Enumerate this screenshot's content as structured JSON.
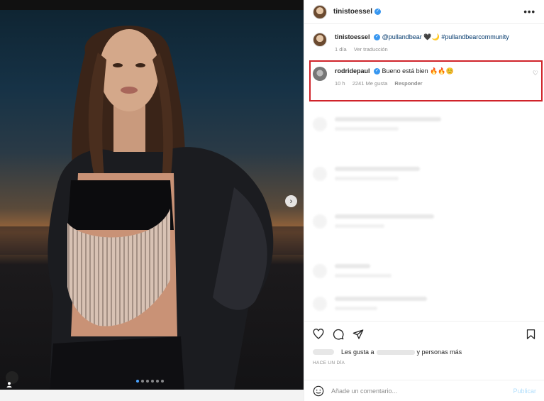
{
  "post": {
    "author": "tinistoessel",
    "more": "•••"
  },
  "caption": {
    "username": "tinistoessel",
    "mention": "@pullandbear",
    "emoji": "🖤🌙",
    "hashtag": "#pullandbearcommunity",
    "time": "1 día",
    "translate": "Ver traducción"
  },
  "highlighted_comment": {
    "username": "rodridepaul",
    "text": "Bueno está bien 🔥🔥😊",
    "time": "10 h",
    "likes": "2241 Me gusta",
    "reply": "Responder"
  },
  "likes": {
    "prefix": "Les gusta a",
    "suffix": "y personas más"
  },
  "timestamp": "HACE UN DÍA",
  "comment_box": {
    "placeholder": "Añade un comentario...",
    "publish": "Publicar"
  },
  "icons": {
    "next": "chevron-right-icon",
    "tag": "user-tag-icon",
    "like": "heart-icon",
    "comment": "comment-icon",
    "share": "share-icon",
    "save": "bookmark-icon",
    "emoji": "emoji-icon"
  },
  "carousel": {
    "count": 6,
    "active": 0
  },
  "colors": {
    "highlight_border": "#d0232a",
    "link": "#00376b",
    "verified": "#3897f0"
  }
}
